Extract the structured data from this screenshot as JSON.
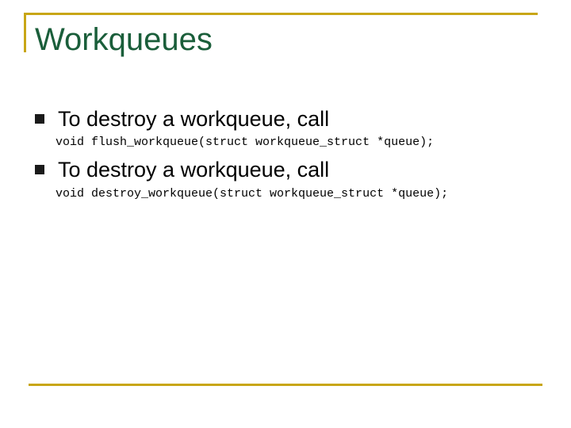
{
  "slide": {
    "title": "Workqueues",
    "bullets": [
      {
        "text": "To destroy a workqueue, call",
        "code": "void flush_workqueue(struct workqueue_struct *queue);"
      },
      {
        "text": "To destroy a workqueue, call",
        "code": "void destroy_workqueue(struct workqueue_struct *queue);"
      }
    ]
  },
  "colors": {
    "accent_frame": "#c8a616",
    "title": "#1a5e3a",
    "text": "#000000"
  },
  "icons": {
    "bullet": "square-bullet-icon"
  }
}
